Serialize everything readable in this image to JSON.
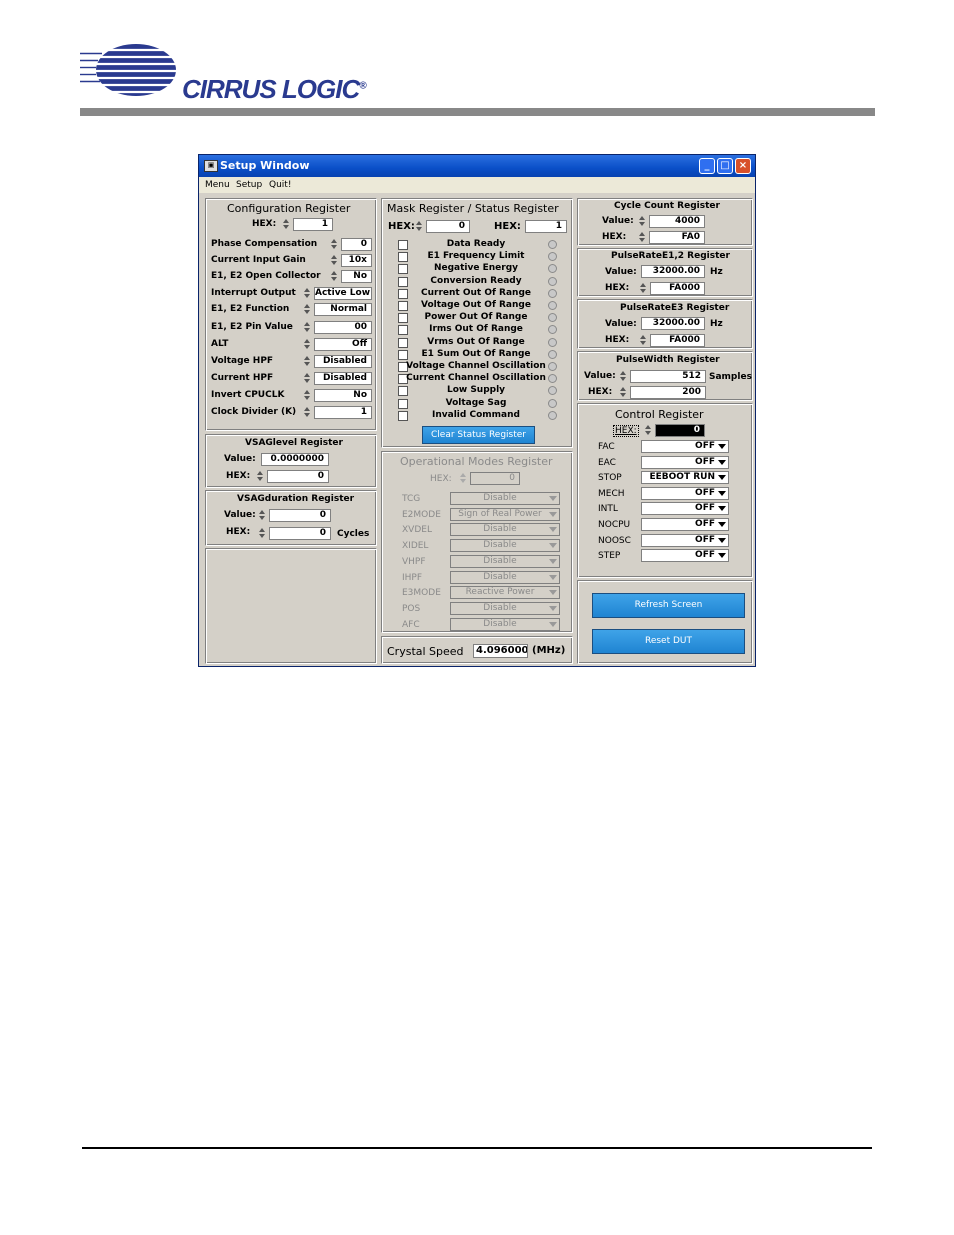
{
  "header": {
    "logo_text": "CIRRUS LOGIC",
    "logo_mark": "®"
  },
  "window": {
    "title": "Setup Window",
    "title_icon": "window-icon",
    "controls": [
      "minimize-icon",
      "maximize-icon",
      "close-icon"
    ],
    "menu": [
      "Menu",
      "Setup",
      "Quit!"
    ]
  },
  "config": {
    "title": "Configuration Register",
    "hex_label": "HEX:",
    "hex_value": "1",
    "rows": [
      {
        "label": "Phase Compensation",
        "value": "0"
      },
      {
        "label": "Current Input Gain",
        "value": "10x"
      },
      {
        "label": "E1, E2 Open Collector",
        "value": "No"
      },
      {
        "label": "Interrupt Output",
        "value": "Active Low"
      },
      {
        "label": "E1, E2 Function",
        "value": "Normal"
      },
      {
        "label": "E1, E2 Pin Value",
        "value": "00"
      },
      {
        "label": "ALT",
        "value": "Off"
      },
      {
        "label": "Voltage HPF",
        "value": "Disabled"
      },
      {
        "label": "Current HPF",
        "value": "Disabled"
      },
      {
        "label": "Invert CPUCLK",
        "value": "No"
      },
      {
        "label": "Clock Divider (K)",
        "value": "1"
      }
    ]
  },
  "vsaglevel": {
    "title": "VSAGlevel Register",
    "value_label": "Value:",
    "value": "0.0000000",
    "hex_label": "HEX:",
    "hex": "0"
  },
  "vsagduration": {
    "title": "VSAGduration Register",
    "value_label": "Value:",
    "value": "0",
    "hex_label": "HEX:",
    "hex": "0",
    "unit": "Cycles"
  },
  "mask": {
    "title": "Mask Register / Status Register",
    "hex1_label": "HEX:",
    "hex1": "0",
    "hex2_label": "HEX:",
    "hex2": "1",
    "items": [
      "Data Ready",
      "E1 Frequency Limit",
      "Negative Energy",
      "Conversion Ready",
      "Current Out Of Range",
      "Voltage Out Of Range",
      "Power Out Of Range",
      "Irms Out Of Range",
      "Vrms Out Of Range",
      "E1 Sum Out Of Range",
      "Voltage Channel Oscillation",
      "Current Channel Oscillation",
      "Low Supply",
      "Voltage Sag",
      "Invalid Command"
    ],
    "clear_button": "Clear Status Register"
  },
  "opmodes": {
    "title": "Operational Modes Register",
    "hex_label": "HEX:",
    "hex": "0",
    "rows": [
      {
        "label": "TCG",
        "value": "Disable"
      },
      {
        "label": "E2MODE",
        "value": "Sign of Real Power"
      },
      {
        "label": "XVDEL",
        "value": "Disable"
      },
      {
        "label": "XIDEL",
        "value": "Disable"
      },
      {
        "label": "VHPF",
        "value": "Disable"
      },
      {
        "label": "IHPF",
        "value": "Disable"
      },
      {
        "label": "E3MODE",
        "value": "Reactive Power"
      },
      {
        "label": "POS",
        "value": "Disable"
      },
      {
        "label": "AFC",
        "value": "Disable"
      }
    ]
  },
  "crystal": {
    "label": "Crystal Speed",
    "value": "4.096000",
    "unit": "(MHz)"
  },
  "cycle": {
    "title": "Cycle Count Register",
    "value_label": "Value:",
    "value": "4000",
    "hex_label": "HEX:",
    "hex": "FA0"
  },
  "pulse12": {
    "title": "PulseRateE1,2 Register",
    "value_label": "Value:",
    "value": "32000.00",
    "unit": "Hz",
    "hex_label": "HEX:",
    "hex": "FA000"
  },
  "pulse3": {
    "title": "PulseRateE3 Register",
    "value_label": "Value:",
    "value": "32000.00",
    "unit": "Hz",
    "hex_label": "HEX:",
    "hex": "FA000"
  },
  "pulsewidth": {
    "title": "PulseWidth Register",
    "value_label": "Value:",
    "value": "512",
    "unit": "Samples",
    "hex_label": "HEX:",
    "hex": "200"
  },
  "control": {
    "title": "Control Register",
    "hex_label": "HEX:",
    "hex": "0",
    "rows": [
      {
        "label": "FAC",
        "value": "OFF"
      },
      {
        "label": "EAC",
        "value": "OFF"
      },
      {
        "label": "STOP",
        "value": "EEBOOT RUN"
      },
      {
        "label": "MECH",
        "value": "OFF"
      },
      {
        "label": "INTL",
        "value": "OFF"
      },
      {
        "label": "NOCPU",
        "value": "OFF"
      },
      {
        "label": "NOOSC",
        "value": "OFF"
      },
      {
        "label": "STEP",
        "value": "OFF"
      }
    ]
  },
  "buttons": {
    "refresh": "Refresh Screen",
    "reset": "Reset DUT"
  }
}
